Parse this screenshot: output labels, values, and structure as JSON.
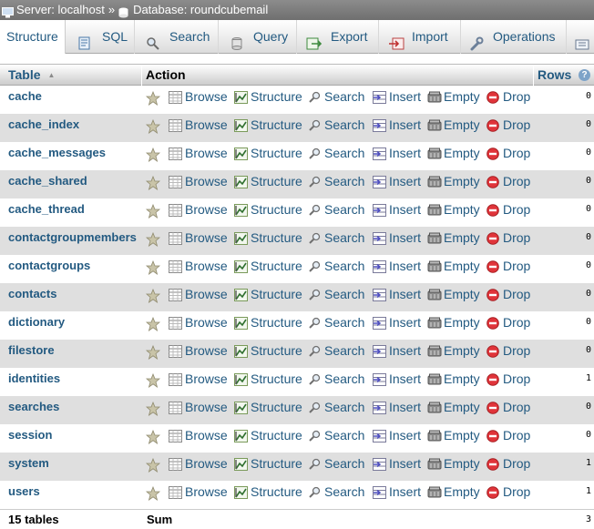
{
  "breadcrumb": {
    "server": "Server: localhost",
    "separator": "»",
    "database": "Database: roundcubemail"
  },
  "tabs": [
    {
      "label": "Structure",
      "icon": "structure-icon"
    },
    {
      "label": "SQL",
      "icon": "sql-icon"
    },
    {
      "label": "Search",
      "icon": "search-icon"
    },
    {
      "label": "Query",
      "icon": "query-icon"
    },
    {
      "label": "Export",
      "icon": "export-icon"
    },
    {
      "label": "Import",
      "icon": "import-icon"
    },
    {
      "label": "Operations",
      "icon": "wrench-icon"
    },
    {
      "label": "",
      "icon": "more-icon"
    }
  ],
  "header": {
    "table": "Table",
    "action": "Action",
    "rows": "Rows",
    "help": "?"
  },
  "actions": {
    "browse": "Browse",
    "structure": "Structure",
    "search": "Search",
    "insert": "Insert",
    "empty": "Empty",
    "drop": "Drop"
  },
  "tables": [
    {
      "name": "cache",
      "rows": "0"
    },
    {
      "name": "cache_index",
      "rows": "0"
    },
    {
      "name": "cache_messages",
      "rows": "0"
    },
    {
      "name": "cache_shared",
      "rows": "0"
    },
    {
      "name": "cache_thread",
      "rows": "0"
    },
    {
      "name": "contactgroupmembers",
      "rows": "0"
    },
    {
      "name": "contactgroups",
      "rows": "0"
    },
    {
      "name": "contacts",
      "rows": "0"
    },
    {
      "name": "dictionary",
      "rows": "0"
    },
    {
      "name": "filestore",
      "rows": "0"
    },
    {
      "name": "identities",
      "rows": "1"
    },
    {
      "name": "searches",
      "rows": "0"
    },
    {
      "name": "session",
      "rows": "0"
    },
    {
      "name": "system",
      "rows": "1"
    },
    {
      "name": "users",
      "rows": "1"
    }
  ],
  "footer": {
    "count": "15 tables",
    "sum": "Sum",
    "rows": "3"
  },
  "colors": {
    "link": "#235a81",
    "row_alt": "#dfdfdf",
    "drop_red": "#e0343a"
  }
}
